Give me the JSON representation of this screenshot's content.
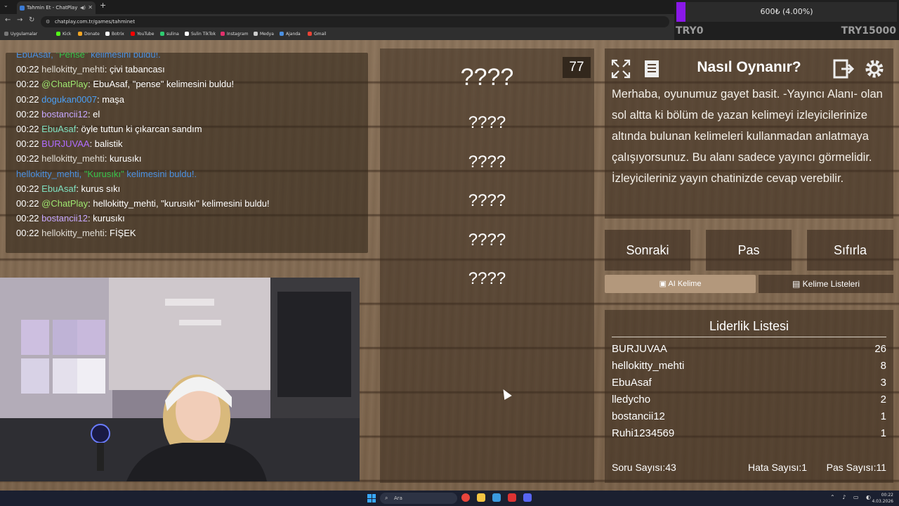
{
  "browser": {
    "tab_title": "Tahmin Et - ChatPlay",
    "url": "chatplay.com.tr/games/tahminet",
    "bookmarks": [
      {
        "label": "Uygulamalar",
        "color": "#777"
      },
      {
        "label": "Kick",
        "color": "#53fc18"
      },
      {
        "label": "Donate",
        "color": "#f5a623"
      },
      {
        "label": "Botrix",
        "color": "#ffffff"
      },
      {
        "label": "YouTube",
        "color": "#ff0000"
      },
      {
        "label": "sulina",
        "color": "#2ecc71"
      },
      {
        "label": "Sulin TikTok",
        "color": "#ffffff"
      },
      {
        "label": "Instagram",
        "color": "#e1306c"
      },
      {
        "label": "Medya",
        "color": "#cccccc"
      },
      {
        "label": "Ajanda",
        "color": "#4a90e2"
      },
      {
        "label": "Gmail",
        "color": "#ea4335"
      }
    ]
  },
  "goal": {
    "text": "600₺ (4.00%)",
    "progress_percent": 4,
    "left_label": "TRY0",
    "right_label": "TRY15000",
    "fill_color": "#8a18e8"
  },
  "chat": {
    "lines": [
      {
        "type": "system",
        "pre": "EbuAsaf, ",
        "word": "\"Pense\"",
        "post": " kelimesini buldu!."
      },
      {
        "time": "00:22",
        "user": "hellokitty_mehti",
        "color": "#e0dcd4",
        "msg": ": çivi tabancası"
      },
      {
        "time": "00:22",
        "user": "@ChatPlay",
        "color": "#9fe870",
        "msg": ": EbuAsaf, \"pense\" kelimesini buldu!"
      },
      {
        "time": "00:22",
        "user": "dogukan0007",
        "color": "#4a9ff5",
        "msg": ": maşa"
      },
      {
        "time": "00:22",
        "user": "bostancii12",
        "color": "#c6a7ff",
        "msg": ": el"
      },
      {
        "time": "00:22",
        "user": "EbuAsaf",
        "color": "#7fe0c0",
        "msg": ": öyle tuttun ki çıkarcan sandım"
      },
      {
        "time": "00:22",
        "user": "BURJUVAA",
        "color": "#b06cff",
        "msg": ": balistik"
      },
      {
        "time": "00:22",
        "user": "hellokitty_mehti",
        "color": "#e0dcd4",
        "msg": ": kurusıkı"
      },
      {
        "type": "system",
        "pre": "hellokitty_mehti, ",
        "word": "\"Kurusıkı\"",
        "post": " kelimesini buldu!."
      },
      {
        "time": "00:22",
        "user": "EbuAsaf",
        "color": "#7fe0c0",
        "msg": ": kurus sıkı"
      },
      {
        "time": "00:22",
        "user": "@ChatPlay",
        "color": "#9fe870",
        "msg": ": hellokitty_mehti, \"kurusıkı\" kelimesini buldu!"
      },
      {
        "time": "00:22",
        "user": "bostancii12",
        "color": "#c6a7ff",
        "msg": ": kurusıkı"
      },
      {
        "time": "00:22",
        "user": "hellokitty_mehti",
        "color": "#e0dcd4",
        "msg": ": FİŞEK"
      }
    ]
  },
  "game": {
    "counter": "77",
    "words": [
      "????",
      "????",
      "????",
      "????",
      "????",
      "????"
    ],
    "how_title": "Nasıl Oynanır?",
    "how_text": "Merhaba, oyunumuz gayet basit. -Yayıncı Alanı- olan sol altta ki bölüm de yazan kelimeyi izleyicilerinize altında bulunan kelimeleri kullanmadan anlatmaya çalışıyorsunuz. Bu alanı sadece yayıncı görmelidir. İzleyicileriniz yayın chatinizde cevap verebilir.",
    "buttons": {
      "next": "Sonraki",
      "pass": "Pas",
      "reset": "Sıfırla"
    },
    "tabs": {
      "ai": "AI Kelime",
      "lists": "Kelime Listeleri"
    },
    "leaderboard": {
      "title": "Liderlik Listesi",
      "rows": [
        {
          "name": "BURJUVAA",
          "score": "26"
        },
        {
          "name": "hellokitty_mehti",
          "score": "8"
        },
        {
          "name": "EbuAsaf",
          "score": "3"
        },
        {
          "name": "lledycho",
          "score": "2"
        },
        {
          "name": "bostancii12",
          "score": "1"
        },
        {
          "name": "Ruhi1234569",
          "score": "1"
        }
      ],
      "questions": "Soru Sayısı:43",
      "errors": "Hata Sayısı:1",
      "passes": "Pas Sayısı:11"
    }
  },
  "taskbar": {
    "search_placeholder": "Ara",
    "time": "00:22",
    "date": "4.03.2026"
  }
}
